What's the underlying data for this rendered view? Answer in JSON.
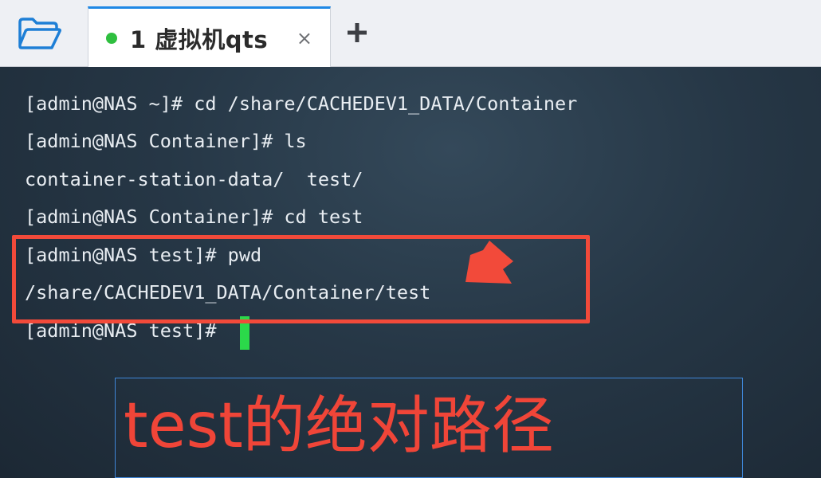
{
  "tabbar": {
    "folder_icon": "folder-open-icon",
    "active_tab": {
      "status_color": "#2fbf3f",
      "label": "1 虚拟机qts",
      "close_glyph": "×"
    },
    "new_tab_icon": "plus-icon"
  },
  "terminal": {
    "lines": [
      "[admin@NAS ~]# cd /share/CACHEDEV1_DATA/Container",
      "[admin@NAS Container]# ls",
      "container-station-data/  test/",
      "[admin@NAS Container]# cd test",
      "[admin@NAS test]# pwd",
      "/share/CACHEDEV1_DATA/Container/test",
      "[admin@NAS test]# "
    ],
    "cursor_color": "#2bd94a"
  },
  "annotation": {
    "highlight_color": "#f24a3a",
    "caption": "test的绝对路径",
    "caption_color": "#f04538",
    "caption_border_color": "#3f86d8"
  }
}
